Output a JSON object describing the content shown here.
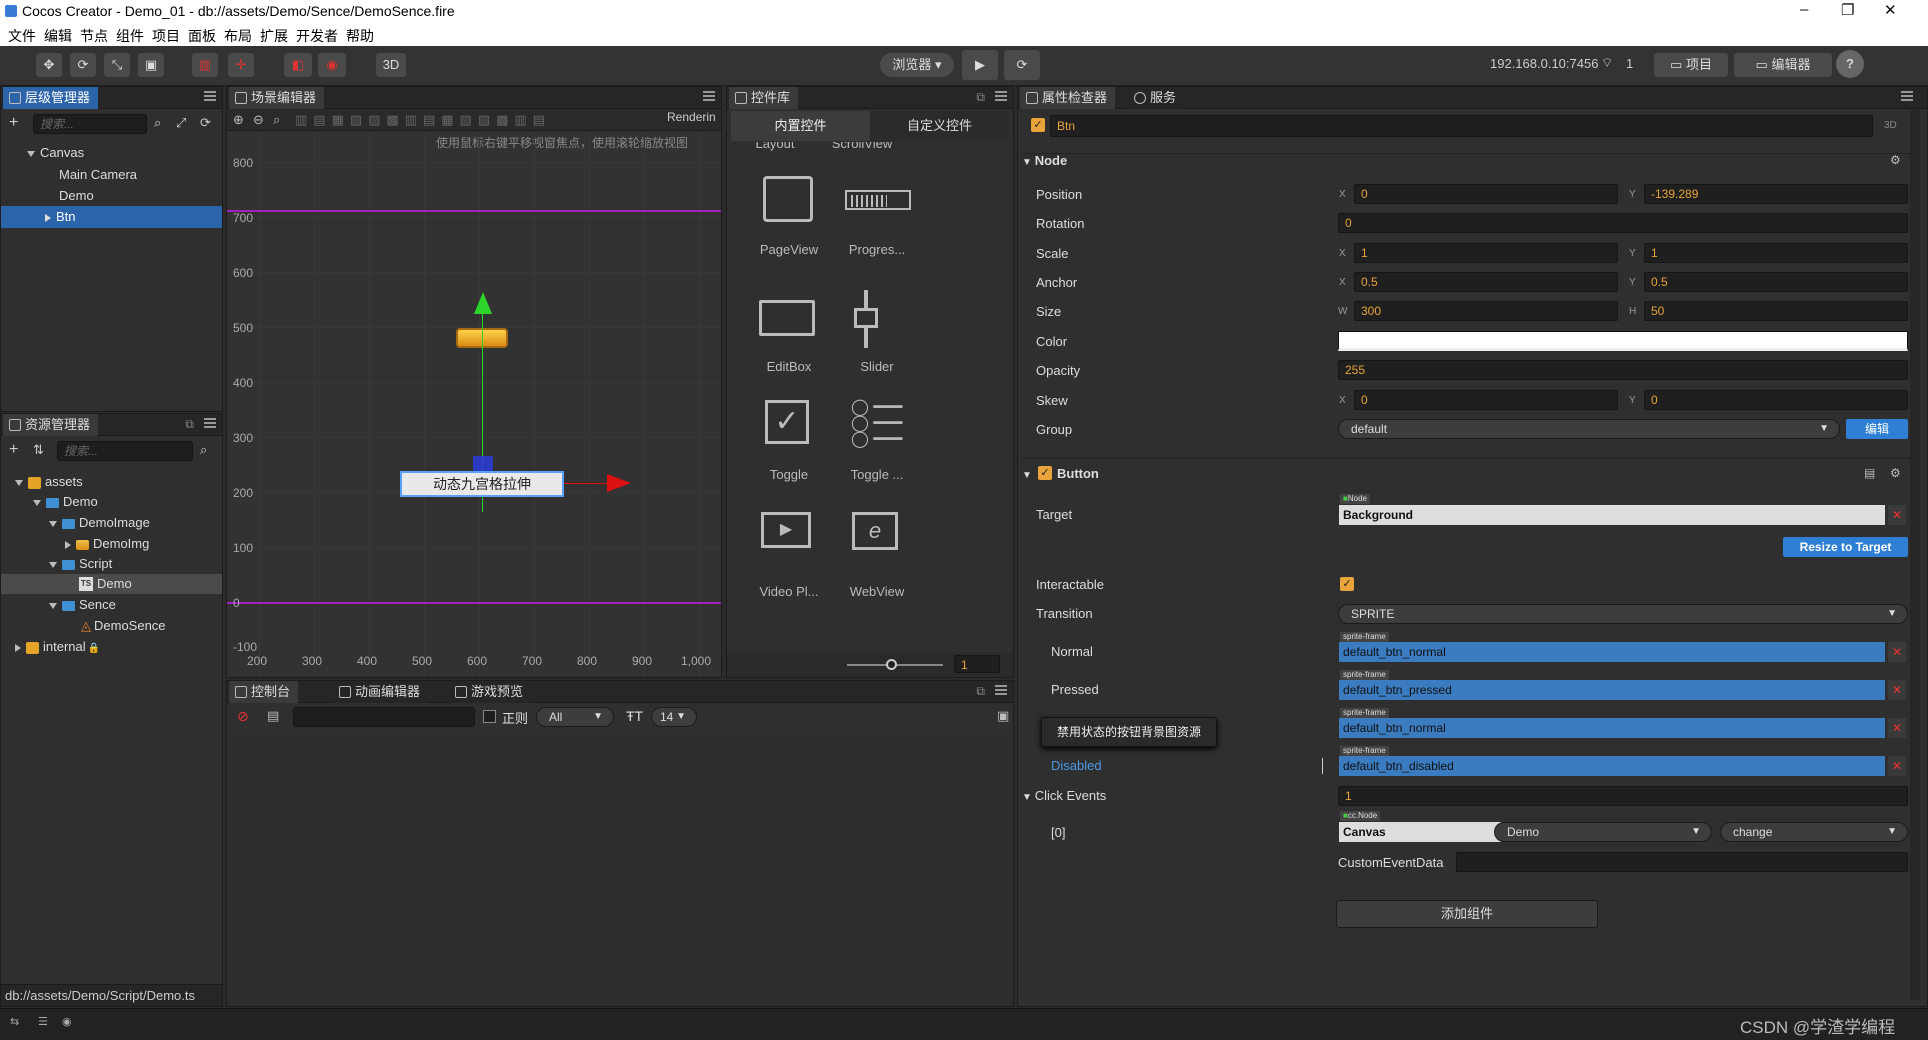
{
  "window": {
    "title": "Cocos Creator - Demo_01 - db://assets/Demo/Sence/DemoSence.fire",
    "controls": [
      "–",
      "❐",
      "✕"
    ]
  },
  "menu": [
    "文件",
    "编辑",
    "节点",
    "组件",
    "项目",
    "面板",
    "布局",
    "扩展",
    "开发者",
    "帮助"
  ],
  "toolbar": {
    "mode3d": "3D",
    "browser": "浏览器 ▾",
    "ip": "192.168.0.10:7456",
    "devices": "1",
    "project_btn": "项目",
    "editor_btn": "编辑器",
    "help": "?"
  },
  "hierarchy": {
    "tab": "层级管理器",
    "search_placeholder": "搜索...",
    "nodes": [
      {
        "label": "Canvas",
        "depth": 0,
        "expanded": true
      },
      {
        "label": "Main Camera",
        "depth": 1
      },
      {
        "label": "Demo",
        "depth": 1
      },
      {
        "label": "Btn",
        "depth": 1,
        "selected": true
      }
    ]
  },
  "assets": {
    "tab": "资源管理器",
    "search_placeholder": "搜索...",
    "items": [
      {
        "label": "assets",
        "depth": 0,
        "type": "root"
      },
      {
        "label": "Demo",
        "depth": 1,
        "type": "folder"
      },
      {
        "label": "DemoImage",
        "depth": 2,
        "type": "folder"
      },
      {
        "label": "DemoImg",
        "depth": 3,
        "type": "image"
      },
      {
        "label": "Script",
        "depth": 2,
        "type": "folder"
      },
      {
        "label": "Demo",
        "depth": 3,
        "type": "script",
        "selected": true
      },
      {
        "label": "Sence",
        "depth": 2,
        "type": "folder"
      },
      {
        "label": "DemoSence",
        "depth": 3,
        "type": "scene"
      },
      {
        "label": "internal",
        "depth": 0,
        "type": "root-locked"
      }
    ],
    "footer_path": "db://assets/Demo/Script/Demo.ts"
  },
  "scene": {
    "tab": "场景编辑器",
    "rendering": "Renderin",
    "hint": "使用鼠标右键平移视窗焦点，使用滚轮缩放视图",
    "y_ticks": [
      "800",
      "700",
      "600",
      "500",
      "400",
      "300",
      "200",
      "100",
      "0",
      "-100"
    ],
    "x_ticks": [
      "200",
      "300",
      "400",
      "500",
      "600",
      "700",
      "800",
      "900",
      "1,000"
    ],
    "button_label": "动态九宫格拉伸"
  },
  "widgets": {
    "tab": "控件库",
    "subtab_builtin": "内置控件",
    "subtab_custom": "自定义控件",
    "cut_labels": [
      "Layout",
      "ScrollView"
    ],
    "items": [
      {
        "label": "PageView",
        "icon": "pageview-icon"
      },
      {
        "label": "Progres...",
        "icon": "progressbar-icon"
      },
      {
        "label": "EditBox",
        "icon": "editbox-icon"
      },
      {
        "label": "Slider",
        "icon": "slider-icon"
      },
      {
        "label": "Toggle",
        "icon": "toggle-icon"
      },
      {
        "label": "Toggle ...",
        "icon": "togglegroup-icon"
      },
      {
        "label": "Video Pl...",
        "icon": "videoplayer-icon"
      },
      {
        "label": "WebView",
        "icon": "webview-icon"
      }
    ],
    "zoom_value": "1"
  },
  "console": {
    "tab_console": "控制台",
    "tab_anim": "动画编辑器",
    "tab_preview": "游戏预览",
    "regex_label": "正则",
    "level": "All",
    "font_size": "14"
  },
  "inspector": {
    "tab": "属性检查器",
    "tab_service": "服务",
    "node_name": "Btn",
    "mode3d": "3D",
    "node_section": "Node",
    "position": {
      "label": "Position",
      "x": "0",
      "y": "-139.289"
    },
    "rotation": {
      "label": "Rotation",
      "value": "0"
    },
    "scale": {
      "label": "Scale",
      "x": "1",
      "y": "1"
    },
    "anchor": {
      "label": "Anchor",
      "x": "0.5",
      "y": "0.5"
    },
    "size": {
      "label": "Size",
      "w": "300",
      "h": "50"
    },
    "color": {
      "label": "Color",
      "value": "#ffffff"
    },
    "opacity": {
      "label": "Opacity",
      "value": "255"
    },
    "skew": {
      "label": "Skew",
      "x": "0",
      "y": "0"
    },
    "group": {
      "label": "Group",
      "value": "default",
      "edit": "编辑"
    },
    "axis": {
      "x": "X",
      "y": "Y",
      "w": "W",
      "h": "H"
    },
    "button_section": "Button",
    "target": {
      "label": "Target",
      "tag": "Node",
      "value": "Background",
      "resize": "Resize to Target"
    },
    "interactable": {
      "label": "Interactable"
    },
    "transition": {
      "label": "Transition",
      "value": "SPRITE"
    },
    "sprite_tag": "sprite-frame",
    "normal": {
      "label": "Normal",
      "value": "default_btn_normal"
    },
    "pressed": {
      "label": "Pressed",
      "value": "default_btn_pressed"
    },
    "hover": {
      "value": "default_btn_normal"
    },
    "tooltip": "禁用状态的按钮背景图资源",
    "disabled": {
      "label": "Disabled",
      "value": "default_btn_disabled"
    },
    "click_events": {
      "label": "Click Events",
      "count": "1"
    },
    "event0": {
      "index": "[0]",
      "tag": "cc.Node",
      "target": "Canvas",
      "component": "Demo",
      "handler": "change"
    },
    "custom_event_data": {
      "label": "CustomEventData",
      "value": ""
    },
    "add_component": "添加组件"
  },
  "watermark": "CSDN @学渣学编程"
}
